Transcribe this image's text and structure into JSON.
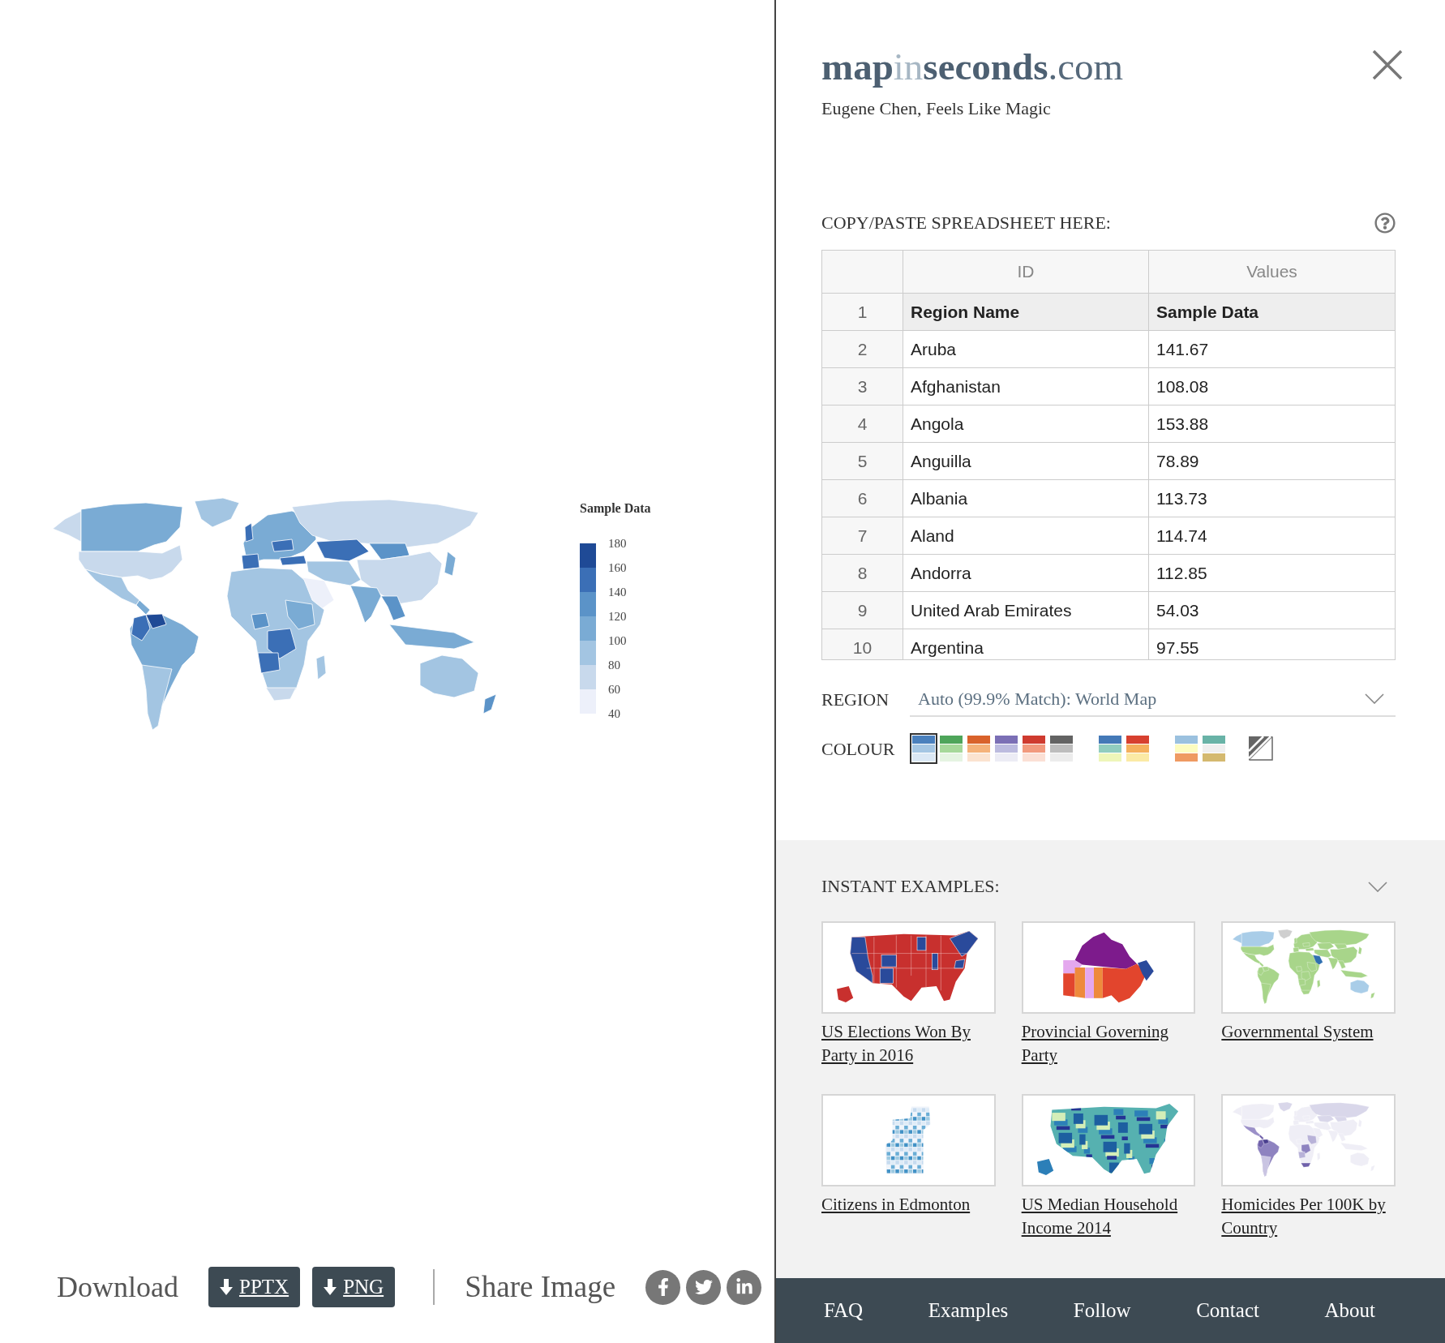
{
  "map": {
    "legend": {
      "title": "Sample Data",
      "bins": [
        {
          "color": "#1f4a96"
        },
        {
          "color": "#3b6fb6"
        },
        {
          "color": "#5b93c8"
        },
        {
          "color": "#7aabd4"
        },
        {
          "color": "#a3c5e2"
        },
        {
          "color": "#c8d9ec"
        },
        {
          "color": "#edf0fa"
        }
      ],
      "ticks": [
        "180",
        "160",
        "140",
        "120",
        "100",
        "80",
        "60",
        "40"
      ]
    }
  },
  "export_bar": {
    "download_label": "Download",
    "buttons": [
      {
        "label": "PPTX"
      },
      {
        "label": "PNG"
      }
    ],
    "share_label": "Share Image"
  },
  "header": {
    "logo": [
      {
        "text": "map",
        "kind": "bold"
      },
      {
        "text": "in",
        "kind": "light"
      },
      {
        "text": "seconds",
        "kind": "bold"
      },
      {
        "text": ".com",
        "kind": "regular"
      }
    ],
    "tagline": "Eugene Chen, Feels Like Magic"
  },
  "spreadsheet": {
    "label": "COPY/PASTE SPREADSHEET HERE:",
    "columns": [
      "ID",
      "Values"
    ],
    "rows": [
      {
        "number": "1",
        "kind": "header",
        "cells": [
          "Region Name",
          "Sample Data"
        ]
      },
      {
        "number": "2",
        "kind": "data",
        "cells": [
          "Aruba",
          "141.67"
        ]
      },
      {
        "number": "3",
        "kind": "data",
        "cells": [
          "Afghanistan",
          "108.08"
        ]
      },
      {
        "number": "4",
        "kind": "data",
        "cells": [
          "Angola",
          "153.88"
        ]
      },
      {
        "number": "5",
        "kind": "data",
        "cells": [
          "Anguilla",
          "78.89"
        ]
      },
      {
        "number": "6",
        "kind": "data",
        "cells": [
          "Albania",
          "113.73"
        ]
      },
      {
        "number": "7",
        "kind": "data",
        "cells": [
          "Aland",
          "114.74"
        ]
      },
      {
        "number": "8",
        "kind": "data",
        "cells": [
          "Andorra",
          "112.85"
        ]
      },
      {
        "number": "9",
        "kind": "data",
        "cells": [
          "United Arab Emirates",
          "54.03"
        ]
      },
      {
        "number": "10",
        "kind": "data",
        "cells": [
          "Argentina",
          "97.55"
        ]
      }
    ]
  },
  "region": {
    "label": "REGION",
    "value": "Auto (99.9% Match): World Map"
  },
  "colour": {
    "label": "COLOUR",
    "palette_groups": [
      [
        {
          "selected": true,
          "bands": [
            {
              "color": "#4a80bd"
            },
            {
              "color": "#a5c6e3"
            },
            {
              "color": "#dbe8f5"
            }
          ]
        },
        {
          "selected": false,
          "bands": [
            {
              "color": "#4ea55a"
            },
            {
              "color": "#a6d89a"
            },
            {
              "color": "#e5f4e2"
            }
          ]
        },
        {
          "selected": false,
          "bands": [
            {
              "color": "#d9622b"
            },
            {
              "color": "#f5b27a"
            },
            {
              "color": "#fbe3d0"
            }
          ]
        },
        {
          "selected": false,
          "bands": [
            {
              "color": "#7b6fb5"
            },
            {
              "color": "#bcbbdf"
            },
            {
              "color": "#ececf5"
            }
          ]
        },
        {
          "selected": false,
          "bands": [
            {
              "color": "#cf3b2f"
            },
            {
              "color": "#f29a7e"
            },
            {
              "color": "#fbe0d5"
            }
          ]
        },
        {
          "selected": false,
          "bands": [
            {
              "color": "#636363"
            },
            {
              "color": "#bdbdbd"
            },
            {
              "color": "#ececec"
            }
          ]
        }
      ],
      [
        {
          "selected": false,
          "bands": [
            {
              "color": "#4479b7"
            },
            {
              "color": "#91cdbf"
            },
            {
              "color": "#eef6b9"
            }
          ]
        },
        {
          "selected": false,
          "bands": [
            {
              "color": "#d7402f"
            },
            {
              "color": "#f5b05d"
            },
            {
              "color": "#fbeaa5"
            }
          ]
        }
      ],
      [
        {
          "selected": false,
          "bands": [
            {
              "color": "#9bc1df"
            },
            {
              "color": "#fdfcc0"
            },
            {
              "color": "#ef9a62"
            }
          ]
        },
        {
          "selected": false,
          "bands": [
            {
              "color": "#69b3a7"
            },
            {
              "color": "#efefef"
            },
            {
              "color": "#d4b96f"
            }
          ]
        }
      ]
    ]
  },
  "examples": {
    "title": "INSTANT EXAMPLES:",
    "items": [
      {
        "title": "US Elections Won By Party in 2016",
        "kind": "elections"
      },
      {
        "title": "Provincial Governing Party",
        "kind": "provinces"
      },
      {
        "title": "Governmental System",
        "kind": "governments"
      },
      {
        "title": "Citizens in Edmonton",
        "kind": "neighbourhoods"
      },
      {
        "title": "US Median Household Income 2014",
        "kind": "counties"
      },
      {
        "title": "Homicides Per 100K by Country",
        "kind": "homicides"
      }
    ]
  },
  "footer": {
    "links": [
      "FAQ",
      "Examples",
      "Follow",
      "Contact",
      "About"
    ]
  }
}
